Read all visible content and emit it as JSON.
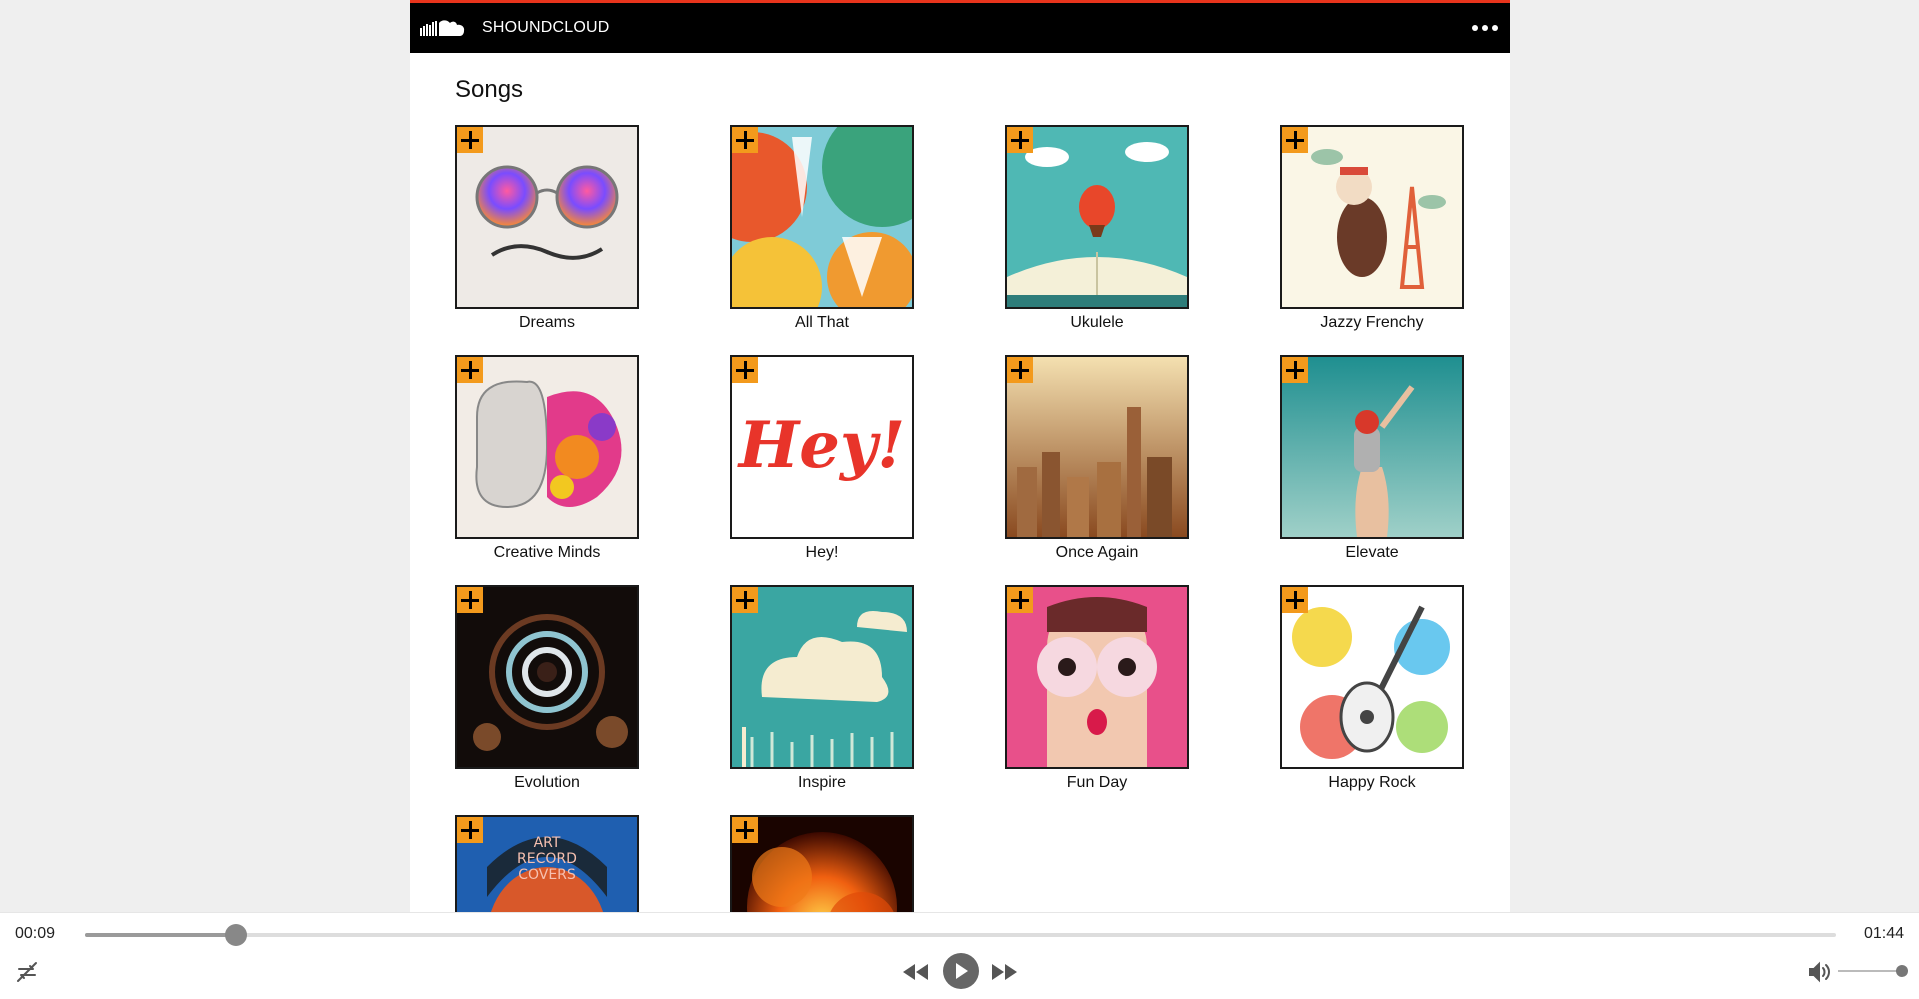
{
  "header": {
    "brand": "SHOUNDCLOUD",
    "logo_icon": "cloud-logo-icon",
    "menu_icon": "more-dots-icon",
    "accent_color": "#e8341c"
  },
  "main": {
    "section_title": "Songs",
    "add_icon": "plus-icon",
    "add_color": "#f39a1c",
    "songs": [
      {
        "title": "Dreams",
        "art": "sunglasses"
      },
      {
        "title": "All That",
        "art": "trumpets"
      },
      {
        "title": "Ukulele",
        "art": "storybook"
      },
      {
        "title": "Jazzy Frenchy",
        "art": "eiffel"
      },
      {
        "title": "Creative Minds",
        "art": "brain"
      },
      {
        "title": "Hey!",
        "art": "hey"
      },
      {
        "title": "Once Again",
        "art": "city"
      },
      {
        "title": "Elevate",
        "art": "jetpack"
      },
      {
        "title": "Evolution",
        "art": "fractal"
      },
      {
        "title": "Inspire",
        "art": "cloud"
      },
      {
        "title": "Fun Day",
        "art": "donuts"
      },
      {
        "title": "Happy Rock",
        "art": "guitar"
      },
      {
        "title": "",
        "art": "record"
      },
      {
        "title": "",
        "art": "fire"
      }
    ]
  },
  "player": {
    "current_time": "00:09",
    "duration": "01:44",
    "progress": 0.0865,
    "volume": 1.0,
    "icons": {
      "repeat": "repeat-icon",
      "rewind": "rewind-icon",
      "play": "play-icon",
      "forward": "fast-forward-icon",
      "volume": "volume-icon"
    }
  }
}
